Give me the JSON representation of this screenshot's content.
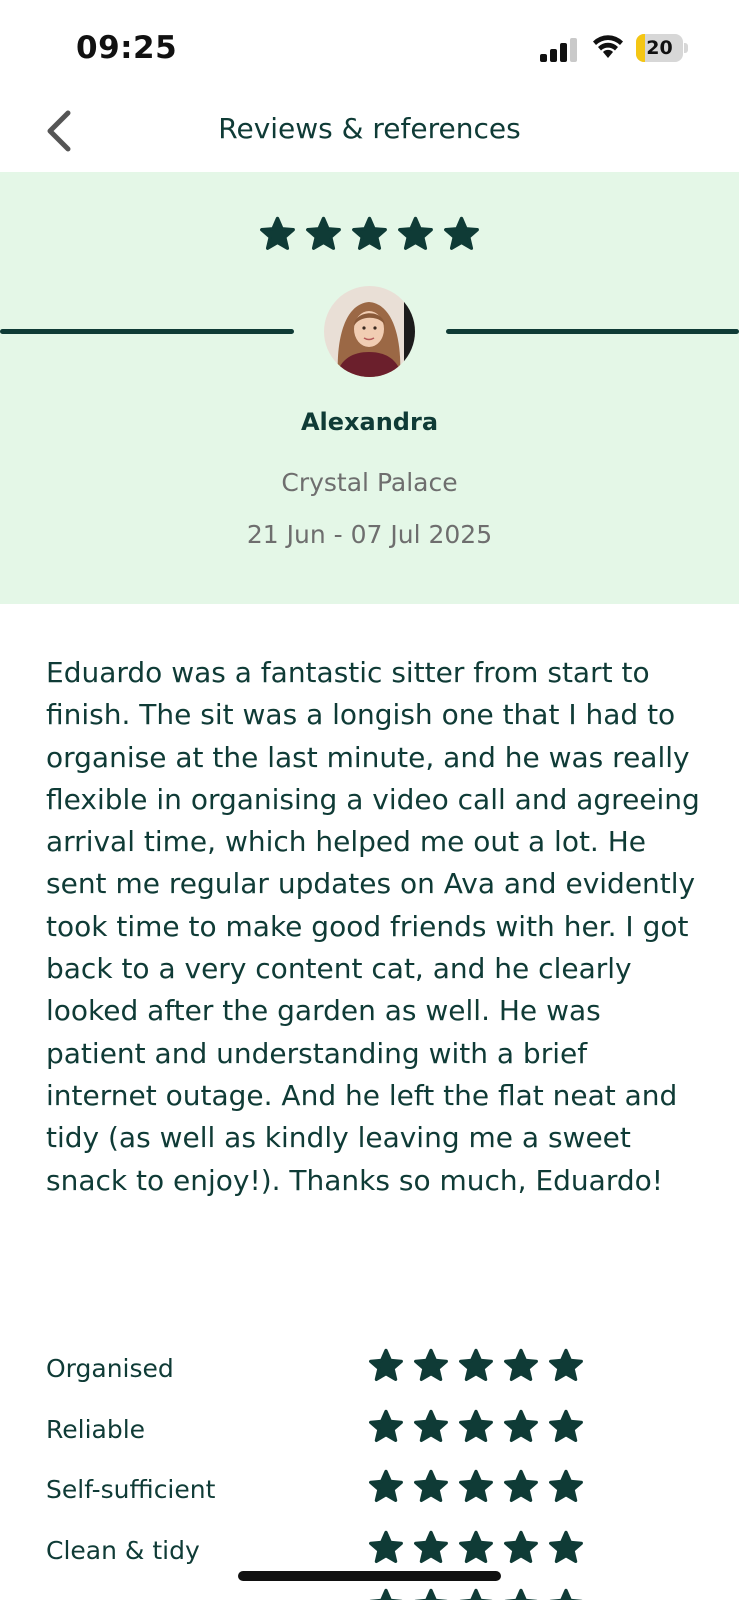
{
  "status_bar": {
    "time": "09:25",
    "battery": "20",
    "battery_level": 0.2,
    "signal_icon": "cellular-signal-icon",
    "wifi_icon": "wifi-icon"
  },
  "nav": {
    "title": "Reviews & references",
    "back_icon": "chevron-left-icon"
  },
  "review": {
    "overall_rating": 5,
    "max_rating": 5,
    "reviewer_name": "Alexandra",
    "location": "Crystal Palace",
    "dates": "21 Jun - 07 Jul 2025",
    "text": "Eduardo was a fantastic sitter from start to finish. The sit was a longish one that I had to organise at the last minute, and he was really flexible in organising a video call and agreeing arrival time, which helped me out a lot. He sent me regular updates on Ava and evidently took time to make good friends with her. I got back to a very content cat, and he clearly looked after the garden as well. He was patient and understanding with a brief internet outage. And he left the flat neat and tidy (as well as kindly leaving me a sweet snack to enjoy!). Thanks so much, Eduardo!"
  },
  "ratings": [
    {
      "label": "Organised",
      "stars": 5
    },
    {
      "label": "Reliable",
      "stars": 5
    },
    {
      "label": "Self-sufficient",
      "stars": 5
    },
    {
      "label": "Clean & tidy",
      "stars": 5
    }
  ],
  "colors": {
    "accent": "#0f3b36",
    "hero_bg": "#e4f7e7",
    "muted_text": "#6e6e6e"
  }
}
